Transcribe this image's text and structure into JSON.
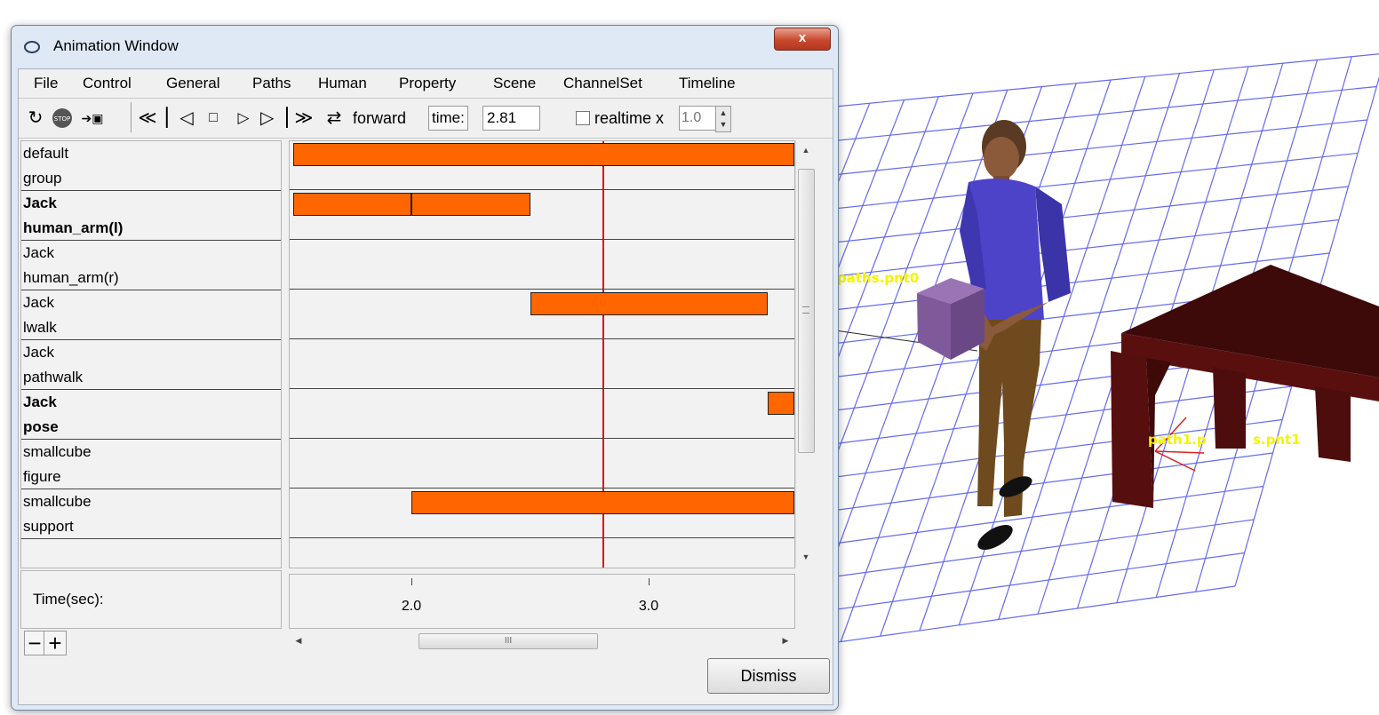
{
  "window": {
    "title": "Animation Window",
    "close_label": "x"
  },
  "menu": [
    "File",
    "Control",
    "General",
    "Paths",
    "Human",
    "Property",
    "Scene",
    "ChannelSet",
    "Timeline"
  ],
  "toolbar": {
    "icons": [
      "reset-icon",
      "stop-icon",
      "record-icon",
      "skip-back-icon",
      "step-back-icon",
      "stop-square-icon",
      "play-icon",
      "step-forward-icon",
      "skip-forward-icon",
      "loop-icon"
    ],
    "stop_text": "STOP",
    "direction": "forward",
    "time_label": "time:",
    "time_value": "2.81",
    "realtime_label": "realtime x",
    "realtime_checked": false,
    "speed_value": "1.0"
  },
  "tracks": [
    {
      "object": "default",
      "type": "group",
      "bold": false
    },
    {
      "object": "Jack",
      "type": "human_arm(l)",
      "bold": true
    },
    {
      "object": "Jack",
      "type": "human_arm(r)",
      "bold": false
    },
    {
      "object": "Jack",
      "type": "lwalk",
      "bold": false
    },
    {
      "object": "Jack",
      "type": "pathwalk",
      "bold": false
    },
    {
      "object": "Jack",
      "type": "pose",
      "bold": true
    },
    {
      "object": "smallcube",
      "type": "figure",
      "bold": false
    },
    {
      "object": "smallcube",
      "type": "support",
      "bold": false
    }
  ],
  "timeline": {
    "time_label": "Time(sec):",
    "ticks": [
      "2.0",
      "3.0"
    ],
    "tick_values": [
      2.0,
      3.0
    ],
    "playhead_time": 2.81,
    "segments": [
      {
        "track": 0,
        "start": 1.5,
        "end": 3.62
      },
      {
        "track": 1,
        "start": 1.5,
        "end": 2.0
      },
      {
        "track": 1,
        "start": 2.0,
        "end": 2.5
      },
      {
        "track": 3,
        "start": 2.5,
        "end": 3.5
      },
      {
        "track": 5,
        "start": 3.5,
        "end": 3.62
      },
      {
        "track": 7,
        "start": 2.0,
        "end": 3.62
      }
    ]
  },
  "zoom": {
    "out": "−",
    "in": "+"
  },
  "hscroll_grip": "III",
  "dismiss_label": "Dismiss",
  "scene": {
    "labels": [
      "paths.pnt0",
      "path1.p",
      "s.pnt1"
    ]
  }
}
